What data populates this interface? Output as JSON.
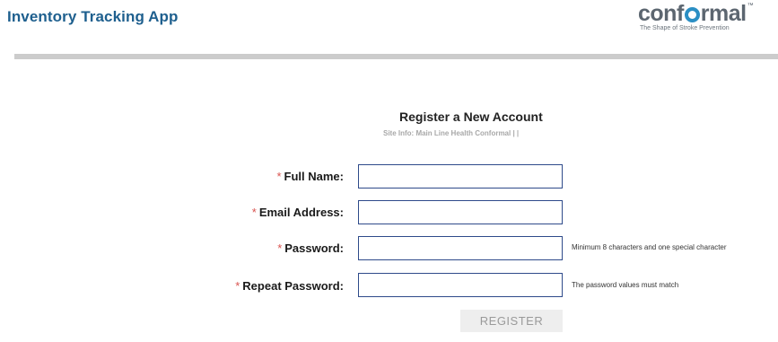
{
  "app": {
    "title": "Inventory Tracking App"
  },
  "logo": {
    "word_prefix": "conf",
    "word_suffix": "rmal",
    "trademark": "™",
    "tagline": "The Shape of Stroke Prevention",
    "colors": {
      "text": "#5c6670",
      "accent": "#2b8fc4"
    }
  },
  "form": {
    "title": "Register a New Account",
    "site_info": "Site Info: Main Line Health Conformal |  |",
    "required_mark": "*",
    "fields": [
      {
        "label": "Full Name:",
        "value": "",
        "placeholder": "",
        "hint": ""
      },
      {
        "label": "Email Address:",
        "value": "",
        "placeholder": "",
        "hint": ""
      },
      {
        "label": "Password:",
        "value": "",
        "placeholder": "",
        "hint": "Minimum 8 characters and one special character"
      },
      {
        "label": "Repeat Password:",
        "value": "",
        "placeholder": "",
        "hint": "The password values must match"
      }
    ],
    "register_label": "REGISTER"
  },
  "colors": {
    "title": "#1e5f8e",
    "required": "#d9534f",
    "input_border": "#2e4a8a",
    "divider": "#cccccc",
    "button_bg": "#eeeeee",
    "button_text": "#9a9a9a"
  }
}
